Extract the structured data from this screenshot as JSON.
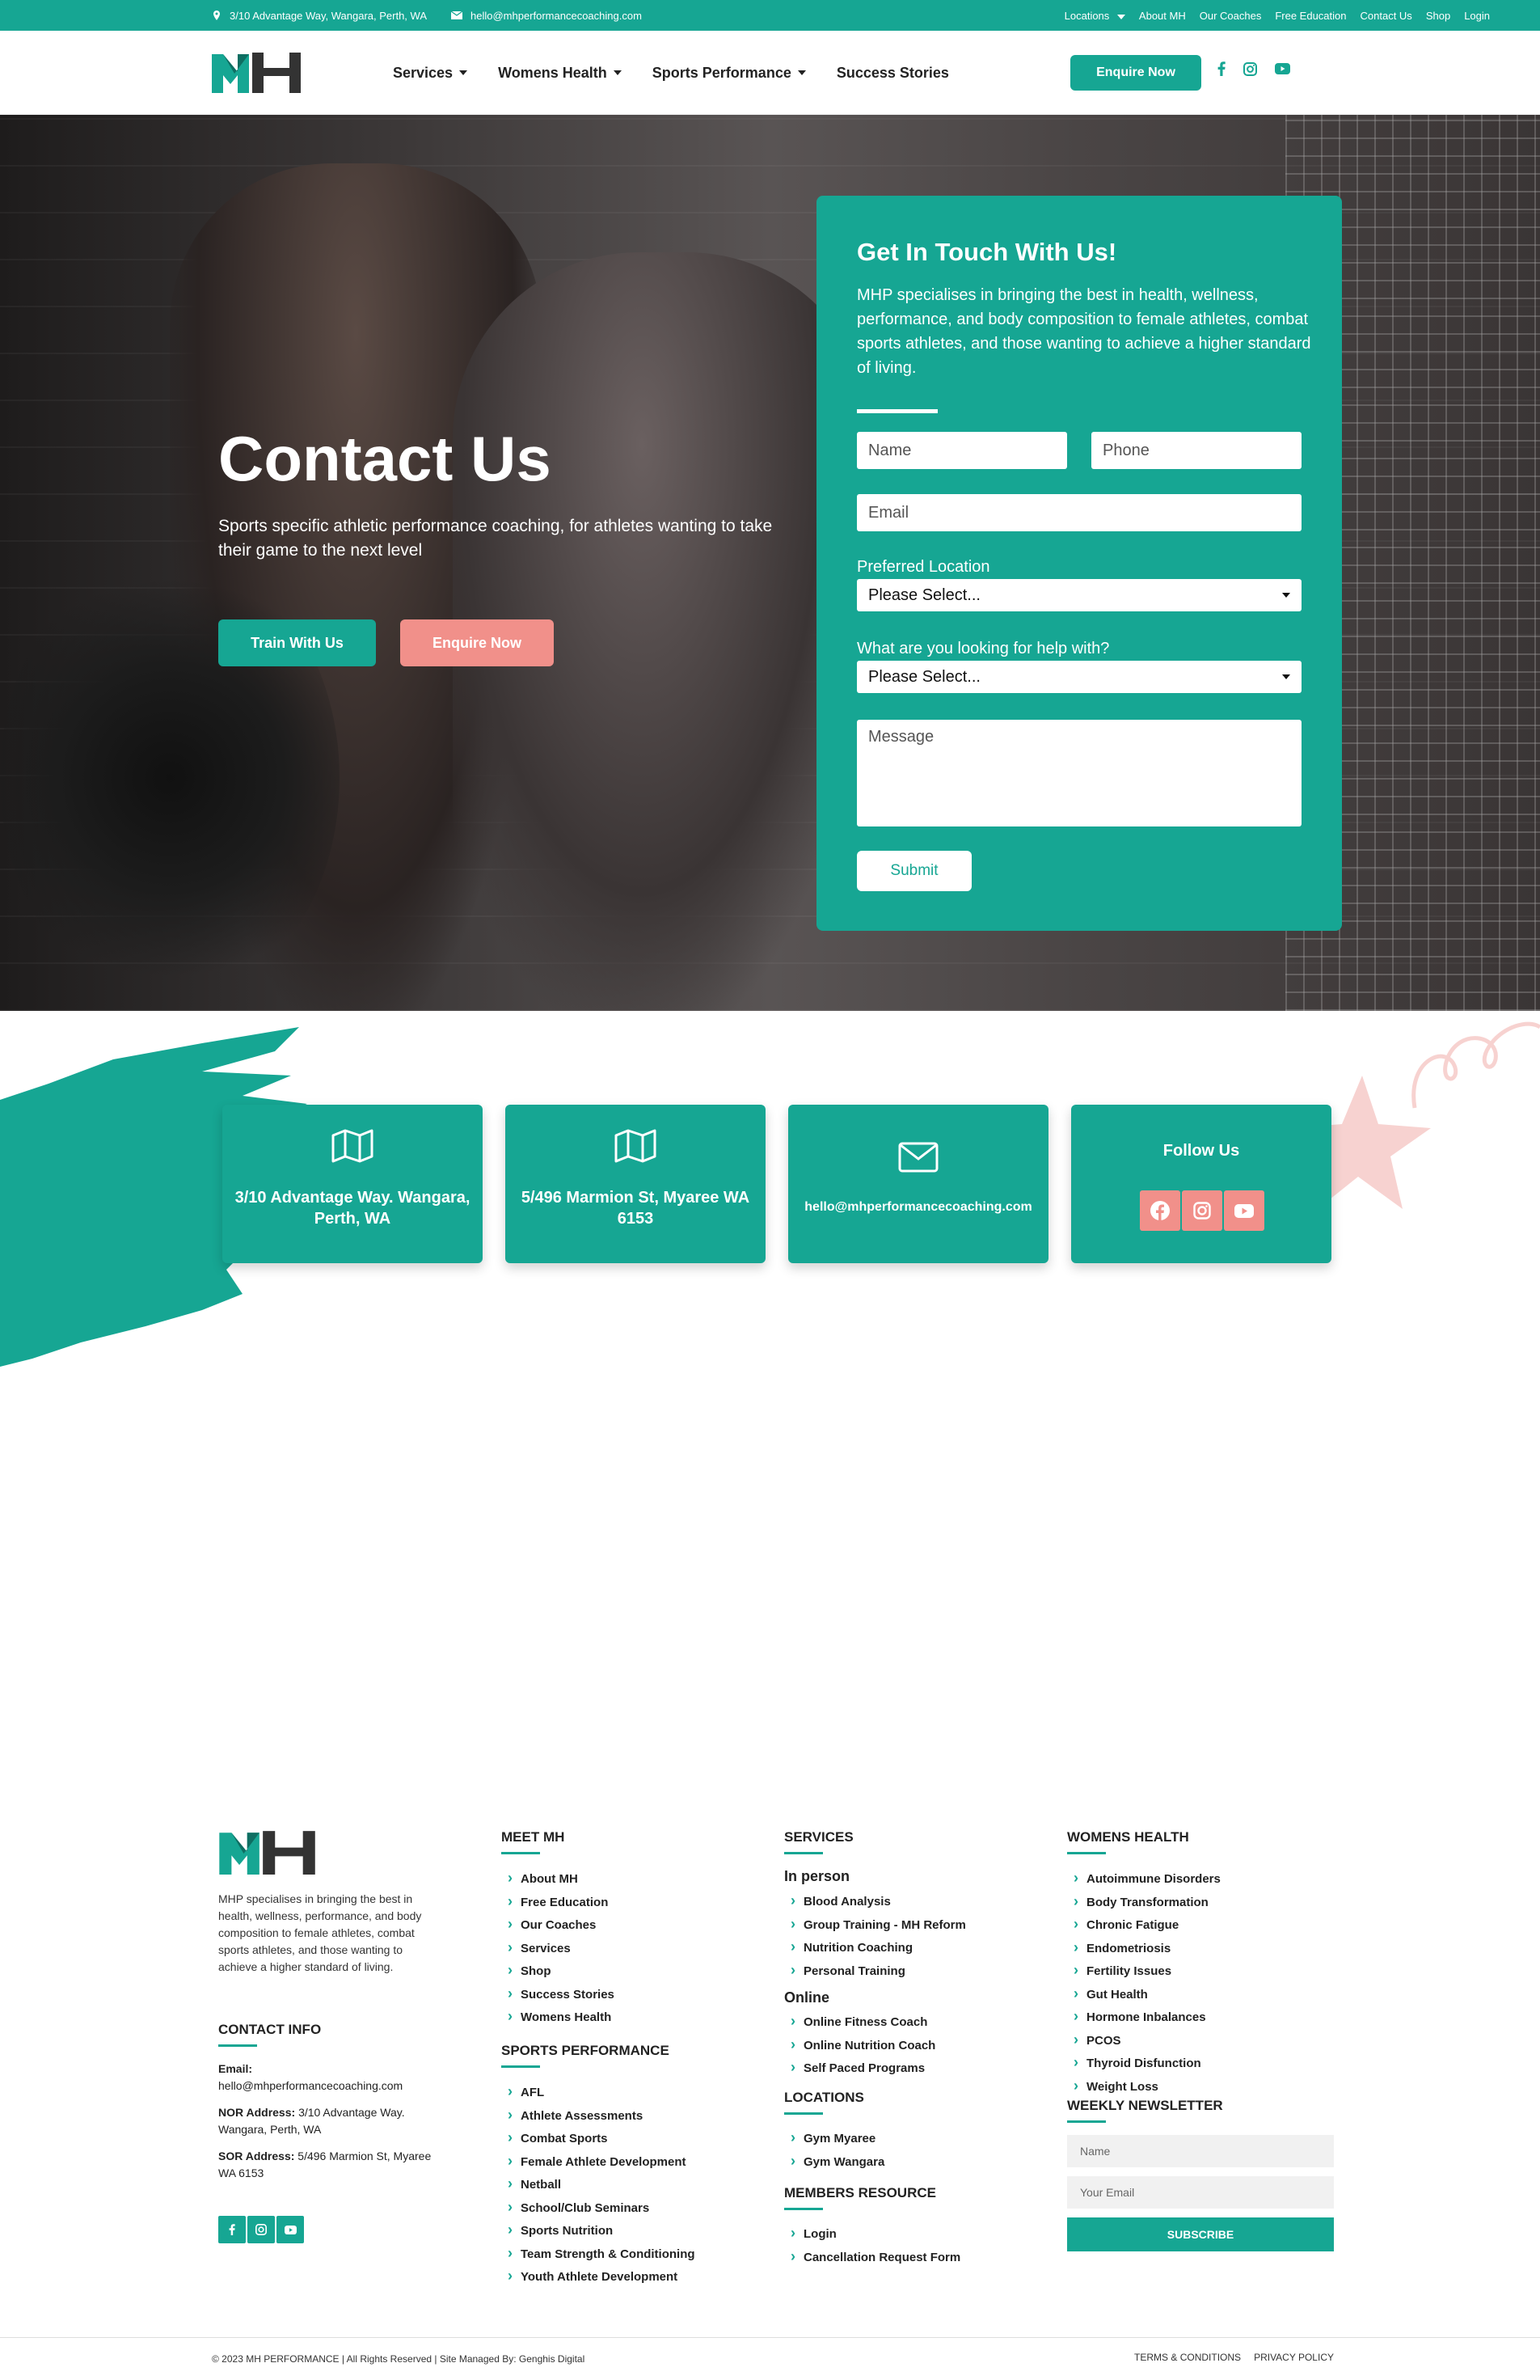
{
  "topbar": {
    "address": "3/10 Advantage Way, Wangara, Perth, WA",
    "email": "hello@mhperformancecoaching.com",
    "links": [
      "Locations",
      "About MH",
      "Our Coaches",
      "Free Education",
      "Contact Us",
      "Shop",
      "Login"
    ]
  },
  "nav": {
    "items": [
      "Services",
      "Womens Health",
      "Sports Performance",
      "Success Stories"
    ],
    "enquire": "Enquire Now"
  },
  "hero": {
    "title": "Contact Us",
    "subtitle": "Sports specific athletic performance coaching, for athletes wanting to take their game to the next level",
    "btn_train": "Train With Us",
    "btn_enquire": "Enquire Now"
  },
  "form": {
    "title": "Get In Touch With Us!",
    "intro": "MHP specialises in bringing the best in health, wellness, performance, and body composition to female athletes, combat sports athletes, and those wanting to achieve a higher standard of living.",
    "name_placeholder": "Name",
    "phone_placeholder": "Phone",
    "email_placeholder": "Email",
    "location_label": "Preferred Location",
    "location_value": "Please Select...",
    "help_label": "What are you looking for help with?",
    "help_value": "Please Select...",
    "message_placeholder": "Message",
    "submit": "Submit"
  },
  "info": {
    "address1": "3/10 Advantage Way. Wangara, Perth, WA",
    "address2": "5/496 Marmion St, Myaree WA 6153",
    "email": "hello@mhperformancecoaching.com",
    "follow": "Follow Us"
  },
  "footer": {
    "desc": "MHP specialises in bringing the best in health, wellness, performance, and body composition to female athletes, combat sports athletes, and those wanting to achieve a higher standard of living.",
    "contact_heading": "CONTACT INFO",
    "email_label": "Email:",
    "email": "hello@mhperformancecoaching.com",
    "nor_label": "NOR Address:",
    "nor": "3/10 Advantage Way. Wangara, Perth, WA",
    "sor_label": "SOR Address:",
    "sor": "5/496 Marmion St, Myaree WA 6153",
    "meet_heading": "MEET MH",
    "meet": [
      "About MH",
      "Free Education",
      "Our Coaches",
      "Services",
      "Shop",
      "Success Stories",
      "Womens Health"
    ],
    "sports_heading": "SPORTS PERFORMANCE",
    "sports": [
      "AFL",
      "Athlete Assessments",
      "Combat Sports",
      "Female Athlete Development",
      "Netball",
      "School/Club Seminars",
      "Sports Nutrition",
      "Team Strength & Conditioning",
      "Youth Athlete Development"
    ],
    "services_heading": "SERVICES",
    "inperson_heading": "In person",
    "inperson": [
      "Blood Analysis",
      "Group Training - MH Reform",
      "Nutrition Coaching",
      "Personal Training"
    ],
    "online_heading": "Online",
    "online": [
      "Online Fitness Coach",
      "Online Nutrition Coach",
      "Self Paced Programs"
    ],
    "locations_heading": "LOCATIONS",
    "locations": [
      "Gym Myaree",
      "Gym Wangara"
    ],
    "members_heading": "MEMBERS RESOURCE",
    "members": [
      "Login",
      "Cancellation Request Form"
    ],
    "womens_heading": "WOMENS HEALTH",
    "womens": [
      "Autoimmune Disorders",
      "Body Transformation",
      "Chronic Fatigue",
      "Endometriosis",
      "Fertility Issues",
      "Gut Health",
      "Hormone Inbalances",
      "PCOS",
      "Thyroid Disfunction",
      "Weight Loss"
    ],
    "newsletter_heading": "WEEKLY NEWSLETTER",
    "nl_name": "Name",
    "nl_email": "Your Email",
    "nl_button": "SUBSCRIBE",
    "copyright": "© 2023 MH PERFORMANCE | All Rights Reserved | Site Managed By: Genghis Digital",
    "terms": "TERMS & CONDITIONS",
    "privacy": "PRIVACY POLICY"
  }
}
